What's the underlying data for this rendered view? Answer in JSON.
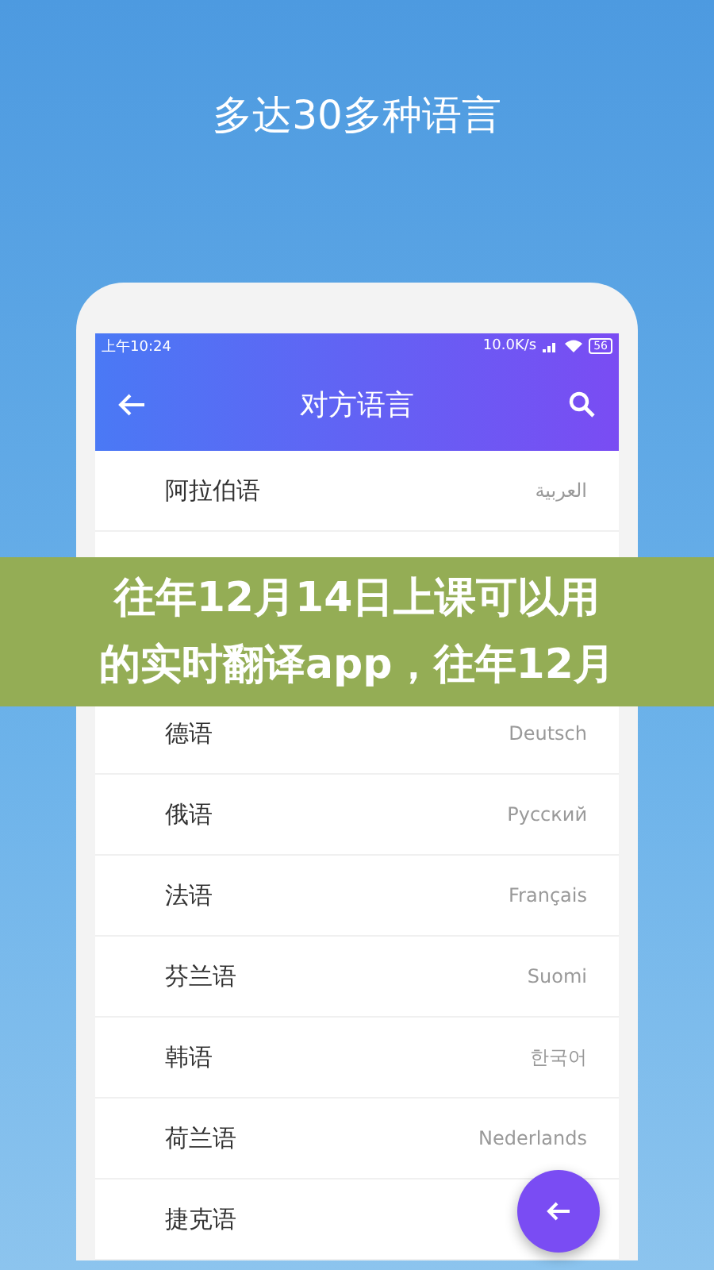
{
  "headline": "多达30多种语言",
  "status_bar": {
    "time": "上午10:24",
    "speed": "10.0K/s",
    "battery": "56"
  },
  "app_bar": {
    "title": "对方语言"
  },
  "languages": [
    {
      "name": "阿拉伯语",
      "native": "العربية"
    },
    {
      "name": "德语",
      "native": "Deutsch"
    },
    {
      "name": "俄语",
      "native": "Русский"
    },
    {
      "name": "法语",
      "native": "Français"
    },
    {
      "name": "芬兰语",
      "native": "Suomi"
    },
    {
      "name": "韩语",
      "native": "한국어"
    },
    {
      "name": "荷兰语",
      "native": "Nederlands"
    },
    {
      "name": "捷克语"
    }
  ],
  "banner": {
    "lines": [
      "往年12月14日上课可以用",
      "的实时翻译app，往年12月"
    ]
  }
}
